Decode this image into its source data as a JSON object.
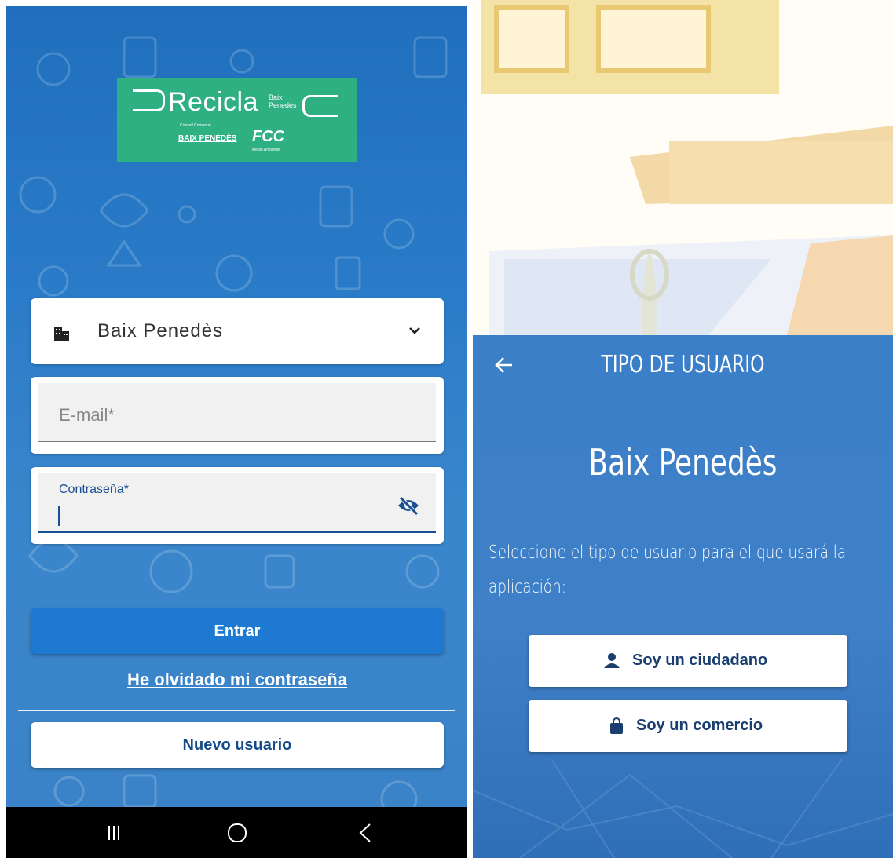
{
  "left_screen": {
    "logo": {
      "brand": "Recicla",
      "brand_sub_1": "Baix",
      "brand_sub_2": "Penedès",
      "council_small_1": "Consell",
      "council_small_2": "Comarcal",
      "council": "BAIX PENEDÈS",
      "partner": "FCC",
      "partner_sub": "Medio Ambiente"
    },
    "location_selector": {
      "value": "Baix Penedès",
      "icon": "building-icon"
    },
    "email": {
      "placeholder": "E-mail*",
      "value": ""
    },
    "password": {
      "label": "Contraseña*",
      "value": ""
    },
    "login_button": "Entrar",
    "forgot_password_link": "He olvidado mi contraseña",
    "new_user_button": "Nuevo usuario",
    "navbar": {
      "recent": "|||",
      "home": "○",
      "back": "<"
    }
  },
  "right_screen": {
    "title": "TIPO DE USUARIO",
    "town": "Baix Penedès",
    "description": "Seleccione el tipo de usuario para el que usará la aplicación:",
    "buttons": {
      "citizen": "Soy un ciudadano",
      "commerce": "Soy un comercio"
    }
  },
  "colors": {
    "blue_bg": "#1f6fbd",
    "logo_green": "#2fb083",
    "primary_button": "#1e7ad1",
    "text_dark_blue": "#134a87"
  }
}
